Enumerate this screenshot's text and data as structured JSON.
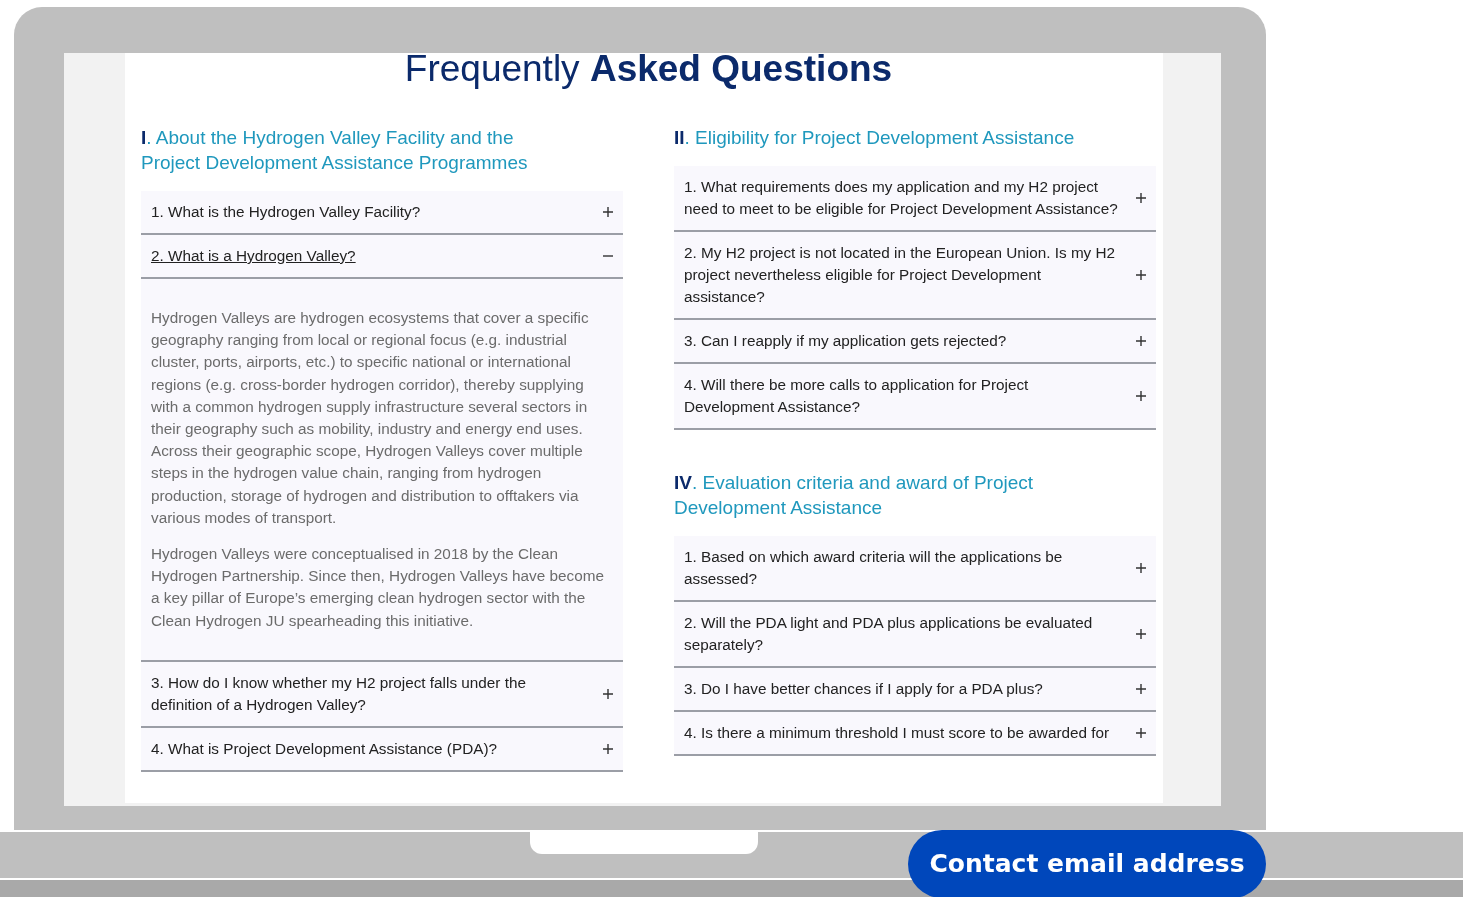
{
  "title": "Frequently **Asked Questions**",
  "columns": [
    {
      "sections": [
        {
          "heading": "**I**. About the Hydrogen Valley Facility and the Project Development Assistance Programmes",
          "items": [
            {
              "question": "1. What is the Hydrogen Valley Facility?",
              "expanded": false
            },
            {
              "question": "2. What is a Hydrogen Valley?",
              "expanded": true,
              "answer": [
                "Hydrogen Valleys are hydrogen ecosystems that cover a specific geography ranging from local or regional focus (e.g. industrial cluster, ports, airports, etc.) to specific national or international regions (e.g. cross-border hydrogen corridor), thereby supplying with a common hydrogen supply infrastructure several sectors in their geography such as mobility, industry and energy end uses. Across their geographic scope, Hydrogen Valleys cover multiple steps in the hydrogen value chain, ranging from hydrogen production, storage of hydrogen and distribution to offtakers via various modes of transport.",
                "Hydrogen Valleys were conceptualised in 2018 by the Clean Hydrogen Partnership. Since then, Hydrogen Valleys have become a key pillar of Europe’s emerging clean hydrogen sector with the Clean Hydrogen JU spearheading this initiative."
              ]
            },
            {
              "question": "3. How do I know whether my H2 project falls under the definition of a Hydrogen Valley?",
              "expanded": false
            },
            {
              "question": "4. What is Project Development Assistance (PDA)?",
              "expanded": false
            }
          ]
        }
      ]
    },
    {
      "sections": [
        {
          "heading": "**II**. Eligibility for Project Development Assistance",
          "items": [
            {
              "question": "1. What requirements does my application and my H2 project need to meet to be eligible for Project Development Assistance?",
              "expanded": false
            },
            {
              "question": "2. My H2 project is not located in the European Union. Is my H2 project nevertheless eligible for Project Development assistance?",
              "expanded": false
            },
            {
              "question": "3. Can I reapply if my application gets rejected?",
              "expanded": false
            },
            {
              "question": "4. Will there be more calls to application for Project Development Assistance?",
              "expanded": false
            }
          ]
        },
        {
          "heading": "**IV**. Evaluation criteria and award of Project Development Assistance",
          "items": [
            {
              "question": "1. Based on which award criteria will the applications be assessed?",
              "expanded": false
            },
            {
              "question": "2. Will the PDA light and PDA plus applications be evaluated separately?",
              "expanded": false
            },
            {
              "question": "3. Do I have better chances if I apply for a PDA plus?",
              "expanded": false
            },
            {
              "question": "4. Is there a minimum threshold I must score to be awarded for",
              "expanded": false
            }
          ]
        }
      ]
    }
  ],
  "contact_button": "Contact email address"
}
